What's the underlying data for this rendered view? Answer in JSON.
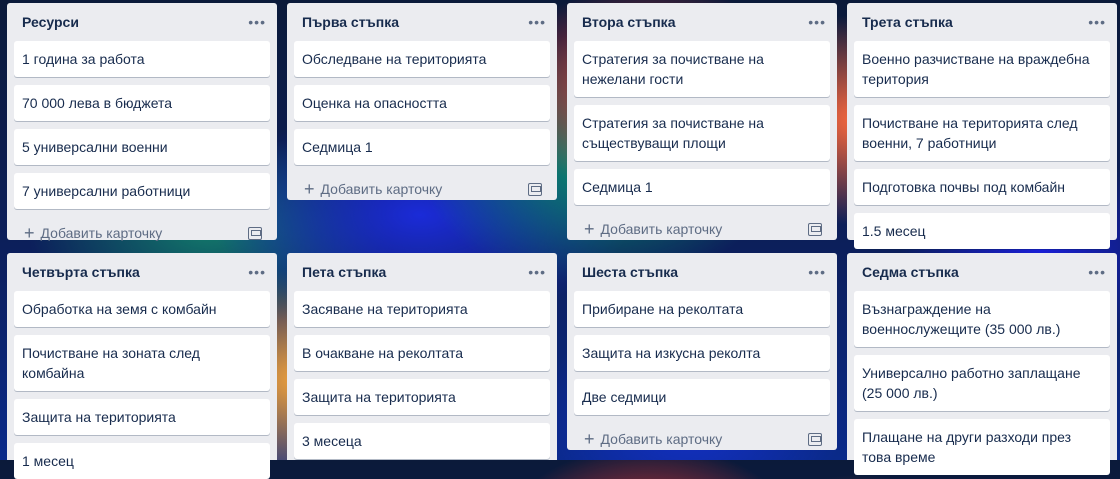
{
  "lists": [
    {
      "title": "Ресурси",
      "cards": [
        "1 година за работа",
        "70 000 лева в бюджета",
        "5 универсални военни",
        "7 универсални работници"
      ],
      "add_label": "Добавить карточку"
    },
    {
      "title": "Първа стъпка",
      "cards": [
        "Обследване на територията",
        "Оценка на опасността",
        "Седмица 1"
      ],
      "add_label": "Добавить карточку"
    },
    {
      "title": "Втора стъпка",
      "cards": [
        "Стратегия за почистване на нежелани гости",
        "Стратегия за почистване на съществуващи площи",
        "Седмица 1"
      ],
      "add_label": "Добавить карточку"
    },
    {
      "title": "Трета стъпка",
      "cards": [
        "Военно разчистване на враждебна територия",
        "Почистване на територията след военни, 7 работници",
        "Подготовка почвы под комбайн",
        "1.5 месец"
      ]
    },
    {
      "title": "Четвърта стъпка",
      "cards": [
        "Обработка на земя с комбайн",
        "Почистване на зоната след комбайна",
        "Защита на територията",
        "1 месец"
      ]
    },
    {
      "title": "Пета стъпка",
      "cards": [
        "Засяване на територията",
        "В очакване на реколтата",
        "Защита на територията",
        "3 месеца"
      ]
    },
    {
      "title": "Шеста стъпка",
      "cards": [
        "Прибиране на реколтата",
        "Защита на изкусна реколта",
        "Две седмици"
      ],
      "add_label": "Добавить карточку"
    },
    {
      "title": "Седма стъпка",
      "cards": [
        "Възнаграждение на военнослужещите (35 000 лв.)",
        "Универсално работно заплащане (25 000 лв.)",
        "Плащане на други разходи през това време"
      ]
    }
  ],
  "icons": {
    "menu": "ellipsis-icon",
    "add": "plus-icon",
    "template": "card-template-icon"
  },
  "colors": {
    "list_bg": "#ebecf0",
    "card_bg": "#ffffff",
    "title_text": "#172b4d",
    "muted_text": "#5e6c84"
  }
}
